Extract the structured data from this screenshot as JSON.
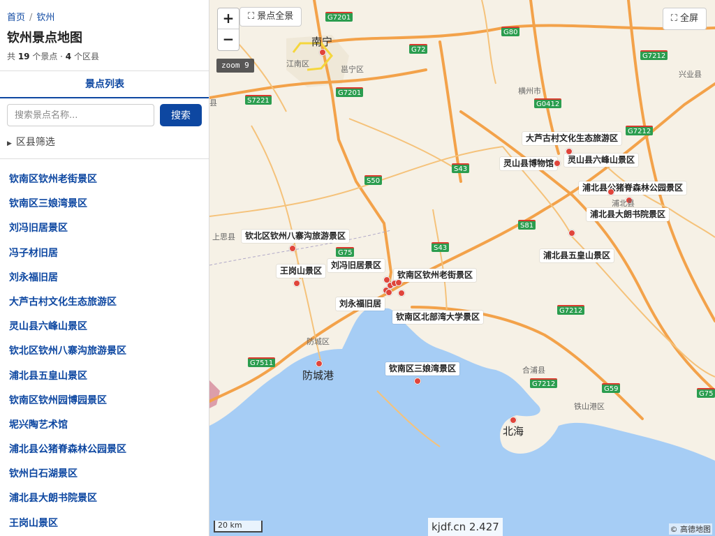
{
  "breadcrumb": {
    "home": "首页",
    "sep": "/",
    "current": "钦州"
  },
  "page_title": "钦州景点地图",
  "summary": {
    "prefix": "共 ",
    "spot_count": "19",
    "mid": " 个景点 · ",
    "county_count": "4",
    "suffix": " 个区县"
  },
  "tab_label": "景点列表",
  "search": {
    "placeholder": "搜索景点名称...",
    "button": "搜索"
  },
  "filter_label": "区县筛选",
  "poi_list": [
    "钦南区钦州老街景区",
    "钦南区三娘湾景区",
    "刘冯旧居景区",
    "冯子材旧居",
    "刘永福旧居",
    "大芦古村文化生态旅游区",
    "灵山县六峰山景区",
    "钦北区钦州八寨沟旅游景区",
    "浦北县五皇山景区",
    "钦南区钦州园博园景区",
    "坭兴陶艺术馆",
    "浦北县公猪脊森林公园景区",
    "钦州白石湖景区",
    "浦北县大朗书院景区",
    "王岗山景区"
  ],
  "map": {
    "zoom_in": "+",
    "zoom_out": "−",
    "overview_button": "⛶ 景点全景",
    "fullscreen_button": "⛶ 全屏",
    "zoom_badge": "zoom 9",
    "scale": "20 km",
    "coord_readout": "kjdf.cn 2.427",
    "attribution": "© 高德地图",
    "labels": [
      "大芦古村文化生态旅游区",
      "灵山县博物馆",
      "灵山县六峰山景区",
      "浦北县公猪脊森林公园景区",
      "浦北县大朗书院景区",
      "钦北区钦州八寨沟旅游景区",
      "浦北县五皇山景区",
      "王岗山景区",
      "刘冯旧居景区",
      "钦南区钦州老街景区",
      "刘永福旧居",
      "钦南区北部湾大学景区",
      "钦南区三娘湾景区"
    ],
    "cities": [
      "南宁",
      "防城港",
      "北海"
    ],
    "places": [
      "江南区",
      "邕宁区",
      "横州市",
      "兴业县",
      "上思县",
      "防城区",
      "合浦县",
      "铁山港区",
      "浦北县",
      "县"
    ],
    "shields": [
      "G7201",
      "G72",
      "G80",
      "G7212",
      "S7221",
      "G7201",
      "G0412",
      "G7212",
      "S43",
      "S50",
      "S81",
      "S43",
      "G75",
      "G7212",
      "G7511",
      "G7212",
      "G59",
      "G75"
    ],
    "colors": {
      "sea": "#a6cdf5",
      "land": "#f6f1e6",
      "highway": "#f3a24a",
      "marker": "#e0453b",
      "accent": "#0d47a1"
    }
  }
}
